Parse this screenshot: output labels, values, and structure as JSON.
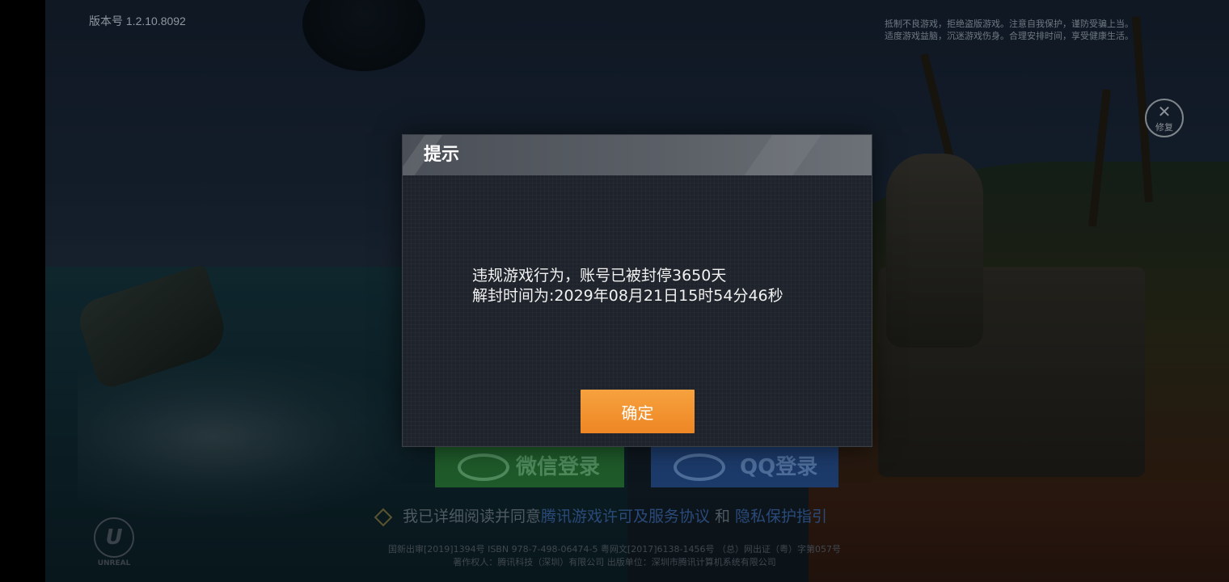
{
  "app": {
    "version": "版本号 1.2.10.8092"
  },
  "header": {
    "health_notice_line1": "抵制不良游戏，拒绝盗版游戏。注意自我保护，谨防受骗上当。",
    "health_notice_line2": "适度游戏益脑，沉迷游戏伤身。合理安排时间，享受健康生活。",
    "repair_label": "修复",
    "repair_icon": "wrench-icon"
  },
  "dialog": {
    "title": "提示",
    "message_line1": "违规游戏行为，账号已被封停3650天",
    "message_line2": "解封时间为:2029年08月21日15时54分46秒",
    "confirm_label": "确定",
    "accent_color": "#F39433",
    "header_color": "#5A5F66",
    "body_color": "#1F232B"
  },
  "login": {
    "wechat_label": "微信登录",
    "wechat_icon": "wechat-icon",
    "wechat_color": "#1F5A2A",
    "qq_label": "QQ登录",
    "qq_icon": "qq-penguin-icon",
    "qq_color": "#1C3A6A",
    "agree_prefix": "我已详细阅读并同意",
    "agree_link1": "腾讯游戏许可及服务协议",
    "agree_and": "和",
    "agree_link2": "隐私保护指引"
  },
  "footer": {
    "license_line1": "国新出审[2019]1394号 ISBN 978-7-498-06474-5 粤网文[2017]6138-1456号 （总）网出证（粤）字第057号",
    "license_line2": "著作权人：腾讯科技（深圳）有限公司 出版单位：深圳市腾讯计算机系统有限公司",
    "engine_logo_text": "UNREAL"
  }
}
